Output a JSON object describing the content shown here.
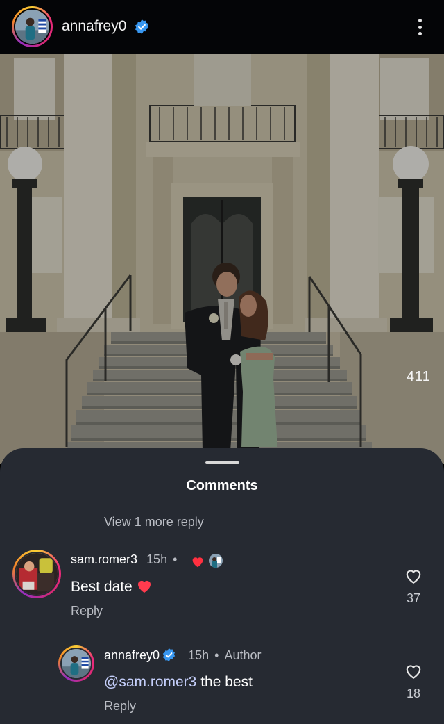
{
  "header": {
    "username": "annafrey0",
    "verified_icon": "verified-badge-icon",
    "menu_icon": "more-vertical-icon"
  },
  "post": {
    "house_number": "411"
  },
  "comments_sheet": {
    "title": "Comments",
    "view_more_replies": "View 1 more reply",
    "comments": [
      {
        "username": "sam.romer3",
        "time": "15h",
        "separator": "•",
        "text": "Best date",
        "reply_label": "Reply",
        "like_count": "37",
        "liked_by_author": true
      },
      {
        "username": "annafrey0",
        "verified": true,
        "time": "15h",
        "separator": "•",
        "author_label": "Author",
        "mention": "@sam.romer3",
        "text": "the best",
        "reply_label": "Reply",
        "like_count": "18"
      }
    ]
  },
  "colors": {
    "sheet_background": "#262a32",
    "verified_blue": "#3897f0",
    "heart_red": "#ff3040",
    "mention": "#c5cffb"
  }
}
